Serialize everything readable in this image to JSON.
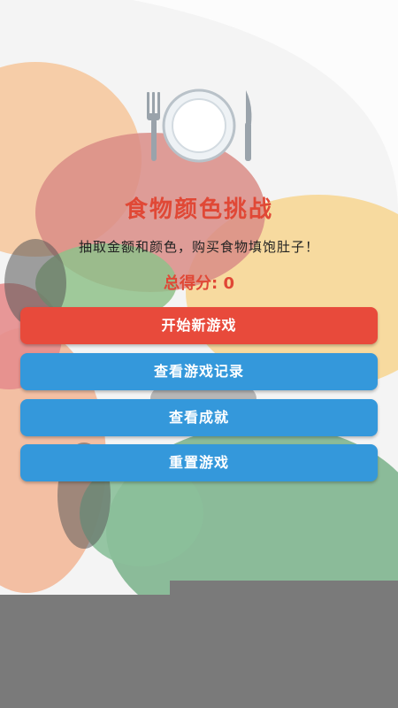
{
  "app": {
    "title": "食物颜色挑战",
    "subtitle": "抽取金额和颜色，购买食物填饱肚子！",
    "score_text": "总得分: 0"
  },
  "buttons": {
    "start": "开始新游戏",
    "records": "查看游戏记录",
    "achievements": "查看成就",
    "reset": "重置游戏"
  },
  "colors": {
    "accent_red": "#e84a3b",
    "accent_blue": "#3498db",
    "title_red": "#e04836"
  },
  "icons": {
    "logo": "plate-fork-knife-icon"
  }
}
